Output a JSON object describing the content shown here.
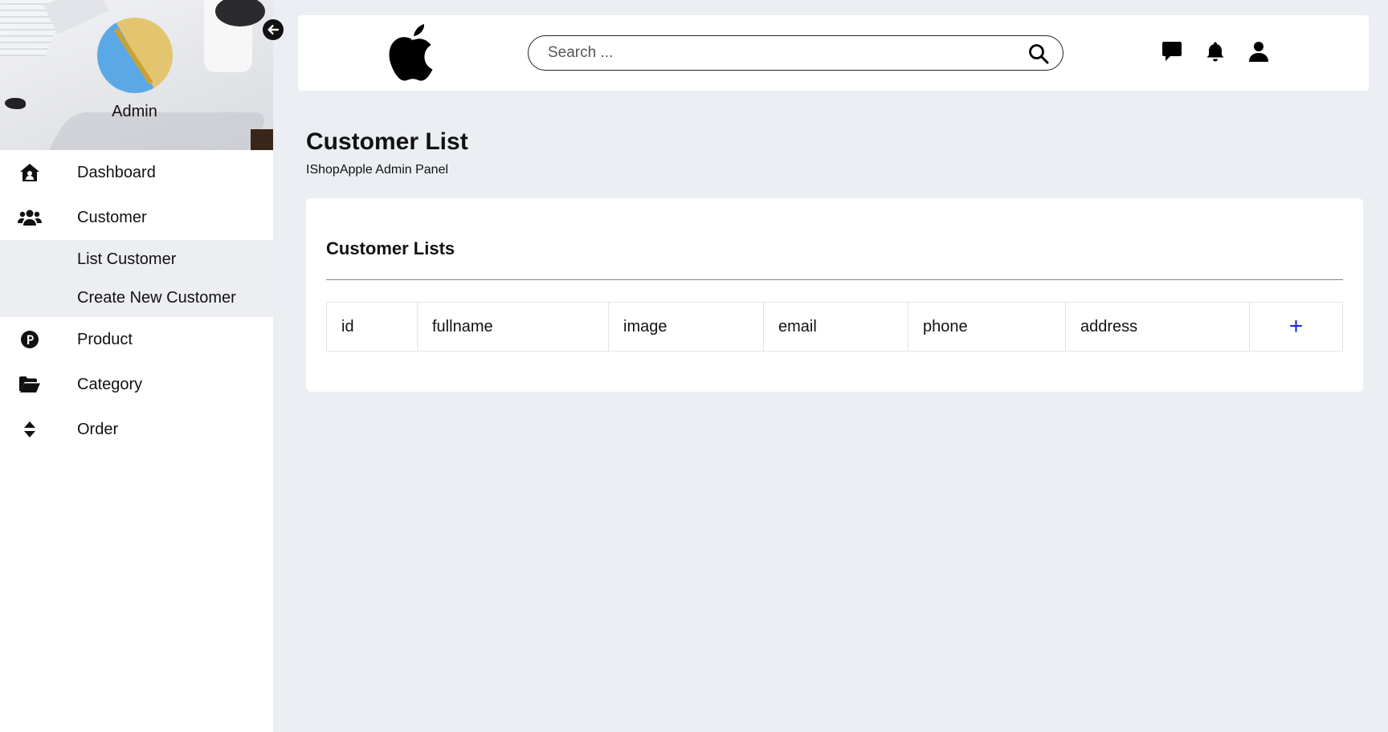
{
  "sidebar": {
    "admin_name": "Admin",
    "items": [
      {
        "label": "Dashboard",
        "icon": "home-icon"
      },
      {
        "label": "Customer",
        "icon": "users-icon"
      },
      {
        "label": "Product",
        "icon": "product-icon"
      },
      {
        "label": "Category",
        "icon": "folder-open-icon"
      },
      {
        "label": "Order",
        "icon": "sort-icon"
      }
    ],
    "customer_submenu": [
      {
        "label": "List Customer"
      },
      {
        "label": "Create New Customer"
      }
    ]
  },
  "header": {
    "logo": "apple-logo-icon",
    "search": {
      "placeholder": "Search ...",
      "value": ""
    },
    "icons": [
      "message-icon",
      "bell-icon",
      "user-icon"
    ]
  },
  "page": {
    "title": "Customer List",
    "subtitle": "IShopApple Admin Panel"
  },
  "card": {
    "title": "Customer Lists",
    "table": {
      "columns": [
        "id",
        "fullname",
        "image",
        "email",
        "phone",
        "address"
      ],
      "add_label": "+",
      "rows": []
    }
  },
  "colors": {
    "background": "#ebeef2",
    "panel": "#ffffff",
    "submenu": "#eceef2",
    "accent_add": "#1a2be0"
  }
}
